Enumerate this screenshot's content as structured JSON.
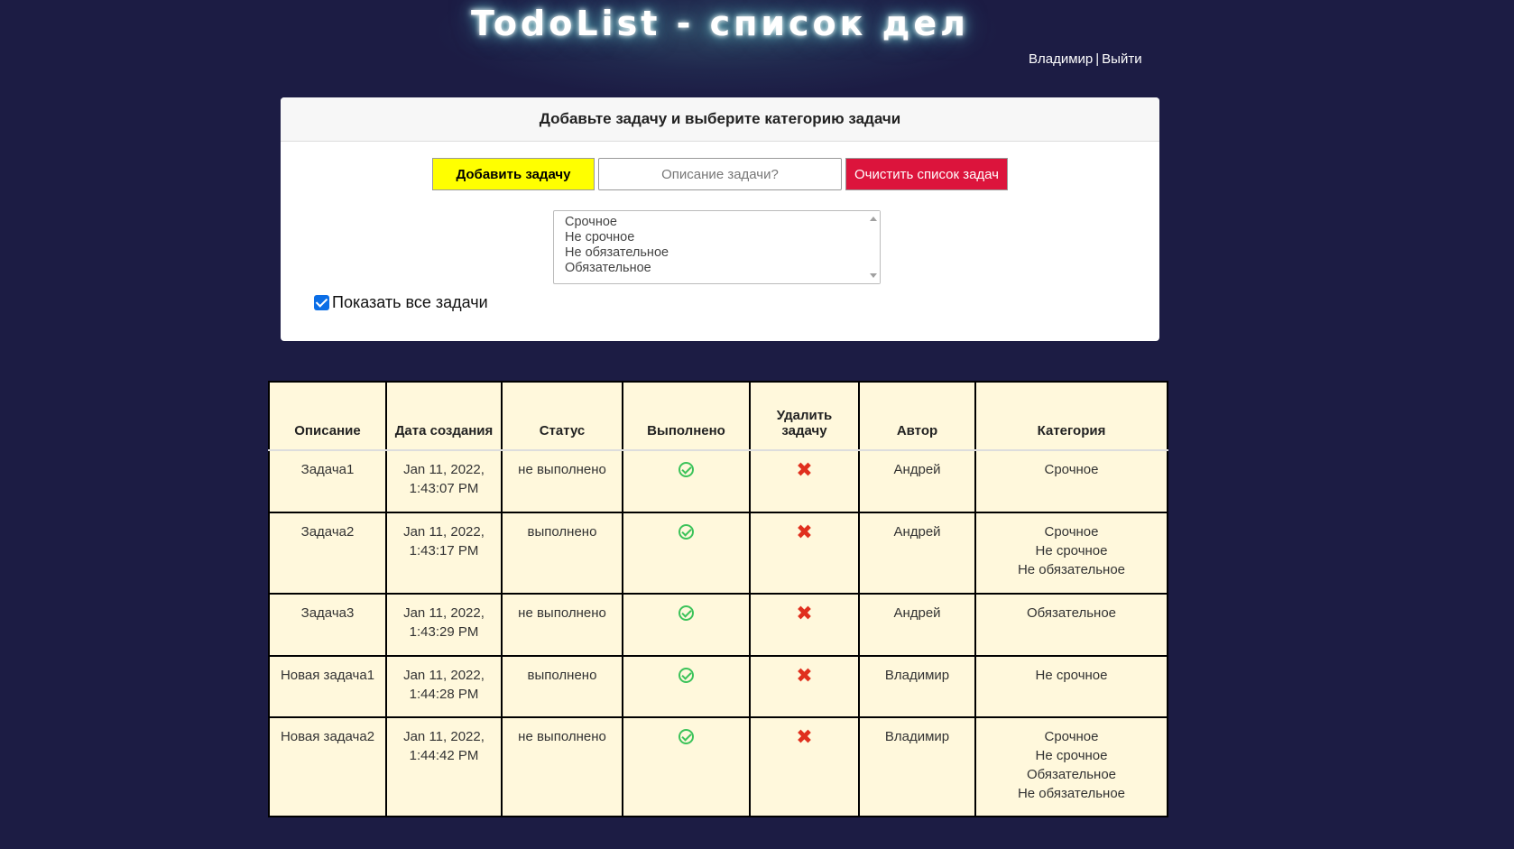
{
  "header": {
    "title": "TodoList - список дел",
    "user_name": "Владимир",
    "separator": "|",
    "logout_label": "Выйти"
  },
  "form": {
    "heading": "Добавьте задачу и выберите категорию задачи",
    "add_button_label": "Добавить задачу",
    "description_placeholder": "Описание задачи?",
    "clear_button_label": "Очистить список задач",
    "categories": [
      "Срочное",
      "Не срочное",
      "Не обязательное",
      "Обязательное"
    ],
    "show_all_label": "Показать все задачи",
    "show_all_checked": true
  },
  "table": {
    "columns": [
      "Описание",
      "Дата создания",
      "Статус",
      "Выполнено",
      "Удалить задачу",
      "Автор",
      "Категория"
    ],
    "rows": [
      {
        "description": "Задача1",
        "date_line1": "Jan 11, 2022,",
        "date_line2": "1:43:07 PM",
        "status": "не выполнено",
        "author": "Андрей",
        "categories": [
          "Срочное"
        ]
      },
      {
        "description": "Задача2",
        "date_line1": "Jan 11, 2022,",
        "date_line2": "1:43:17 PM",
        "status": "выполнено",
        "author": "Андрей",
        "categories": [
          "Срочное",
          "Не срочное",
          "Не обязательное"
        ]
      },
      {
        "description": "Задача3",
        "date_line1": "Jan 11, 2022,",
        "date_line2": "1:43:29 PM",
        "status": "не выполнено",
        "author": "Андрей",
        "categories": [
          "Обязательное"
        ]
      },
      {
        "description": "Новая задача1",
        "date_line1": "Jan 11, 2022,",
        "date_line2": "1:44:28 PM",
        "status": "выполнено",
        "author": "Владимир",
        "categories": [
          "Не срочное"
        ]
      },
      {
        "description": "Новая задача2",
        "date_line1": "Jan 11, 2022,",
        "date_line2": "1:44:42 PM",
        "status": "не выполнено",
        "author": "Владимир",
        "categories": [
          "Срочное",
          "Не срочное",
          "Обязательное",
          "Не обязательное"
        ]
      }
    ]
  },
  "icons": {
    "done": "check-circle-icon",
    "delete": "cross-icon"
  },
  "colors": {
    "background": "#1c1c44",
    "add_button": "#ffff00",
    "clear_button": "#dc143c",
    "table_background": "#fff8dc",
    "done_icon": "#3cc35a",
    "delete_icon": "#e0301e"
  }
}
